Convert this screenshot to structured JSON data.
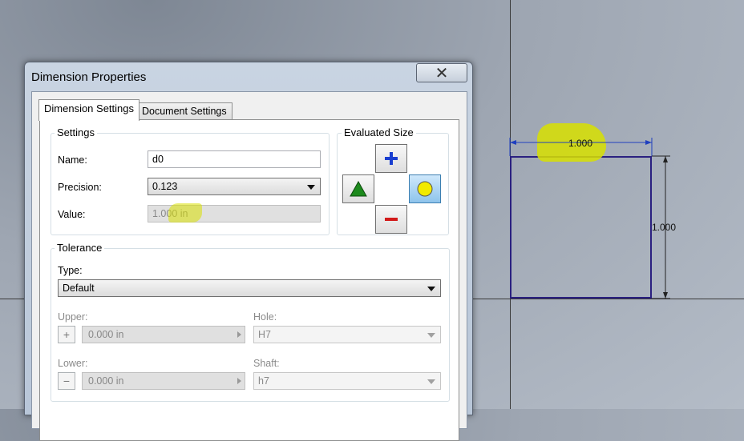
{
  "dialog": {
    "title": "Dimension Properties",
    "close_glyph": "✕"
  },
  "tabs": [
    {
      "label": "Dimension Settings",
      "active": true
    },
    {
      "label": "Document Settings",
      "active": false
    }
  ],
  "settings": {
    "legend": "Settings",
    "name_label": "Name:",
    "name_value": "d0",
    "precision_label": "Precision:",
    "precision_value": "0.123",
    "value_label": "Value:",
    "value_value": "1.000 in"
  },
  "evaluated_size": {
    "legend": "Evaluated Size",
    "buttons": [
      "plus-icon",
      "triangle-icon",
      "circle-icon",
      "minus-icon"
    ],
    "colors": {
      "plus": "#1a3fd0",
      "triangle": "#1c8a1c",
      "circle": "#f2ea00",
      "minus": "#d21a1a"
    }
  },
  "tolerance": {
    "legend": "Tolerance",
    "type_label": "Type:",
    "type_value": "Default",
    "upper_label": "Upper:",
    "upper_value": "0.000 in",
    "lower_label": "Lower:",
    "lower_value": "0.000 in",
    "hole_label": "Hole:",
    "hole_value": "H7",
    "shaft_label": "Shaft:",
    "shaft_value": "h7",
    "plus_glyph": "+",
    "minus_glyph": "−"
  },
  "sketch": {
    "horizontal_dim": "1.000",
    "vertical_dim": "1.000"
  }
}
